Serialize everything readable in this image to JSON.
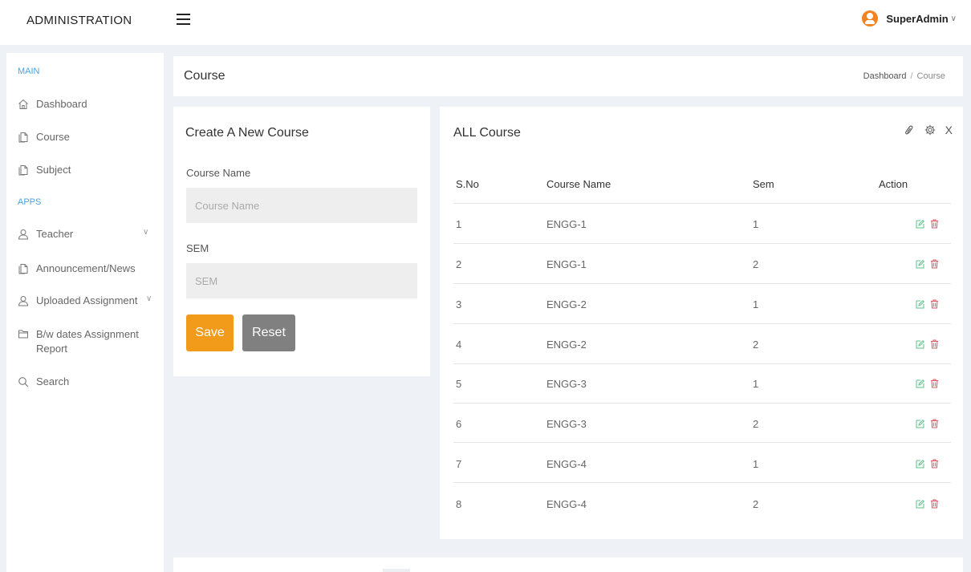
{
  "header": {
    "brand": "ADMINISTRATION",
    "user_name": "SuperAdmin",
    "user_caret": "∨"
  },
  "sidebar": {
    "sections": [
      {
        "label": "MAIN"
      },
      {
        "label": "APPS"
      }
    ],
    "items": [
      {
        "label": "Dashboard",
        "icon": "home-icon"
      },
      {
        "label": "Course",
        "icon": "document-icon"
      },
      {
        "label": "Subject",
        "icon": "document-icon"
      },
      {
        "label": "Teacher",
        "icon": "user-icon",
        "caret": "∨"
      },
      {
        "label": "Announcement/News",
        "icon": "document-icon"
      },
      {
        "label": "Uploaded Assignment",
        "icon": "user-icon",
        "caret": "∨"
      },
      {
        "label": "B/w dates Assignment Report",
        "icon": "folder-icon"
      },
      {
        "label": "Search",
        "icon": "search-icon"
      }
    ]
  },
  "page": {
    "title": "Course",
    "breadcrumb": {
      "home": "Dashboard",
      "separator": "/",
      "current": "Course"
    }
  },
  "form": {
    "title": "Create A New Course",
    "course_name_label": "Course Name",
    "course_name_placeholder": "Course Name",
    "course_name_value": "",
    "sem_label": "SEM",
    "sem_placeholder": "SEM",
    "sem_value": "",
    "save_label": "Save",
    "reset_label": "Reset",
    "save_color": "#f29b1a",
    "reset_color": "#808080"
  },
  "table": {
    "title": "ALL Course",
    "tools": [
      "link-icon",
      "settings-icon",
      "close-icon"
    ],
    "close_glyph": "X",
    "columns": [
      "S.No",
      "Course Name",
      "Sem",
      "Action"
    ],
    "rows": [
      {
        "sno": "1",
        "course": "ENGG-1",
        "sem": "1"
      },
      {
        "sno": "2",
        "course": "ENGG-1",
        "sem": "2"
      },
      {
        "sno": "3",
        "course": "ENGG-2",
        "sem": "1"
      },
      {
        "sno": "4",
        "course": "ENGG-2",
        "sem": "2"
      },
      {
        "sno": "5",
        "course": "ENGG-3",
        "sem": "1"
      },
      {
        "sno": "6",
        "course": "ENGG-3",
        "sem": "2"
      },
      {
        "sno": "7",
        "course": "ENGG-4",
        "sem": "1"
      },
      {
        "sno": "8",
        "course": "ENGG-4",
        "sem": "2"
      }
    ],
    "edit_color": "#5cc28a",
    "delete_color": "#e0555f"
  }
}
